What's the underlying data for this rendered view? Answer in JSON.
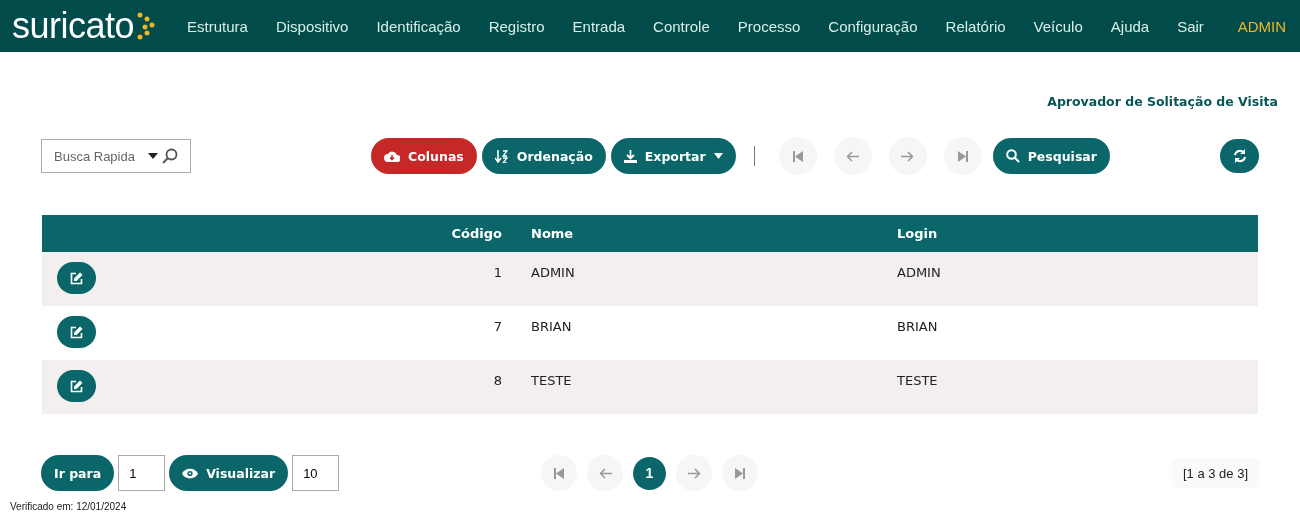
{
  "header": {
    "logo": "suricato",
    "menu": [
      "Estrutura",
      "Dispositivo",
      "Identificação",
      "Registro",
      "Entrada",
      "Controle",
      "Processo",
      "Configuração",
      "Relatório",
      "Veículo",
      "Ajuda",
      "Sair"
    ],
    "user": "ADMIN"
  },
  "page_title": "Aprovador de Solitação de Visita",
  "toolbar": {
    "quick_search": {
      "placeholder": "Busca Rapida"
    },
    "buttons": [
      {
        "label": "Colunas",
        "kind": "danger"
      },
      {
        "label": "Ordenação",
        "kind": "primary"
      },
      {
        "label": "Exportar",
        "kind": "primary"
      }
    ],
    "nav": [
      {
        "disabled": true
      },
      {
        "disabled": true
      },
      {
        "disabled": true
      },
      {
        "disabled": true
      }
    ],
    "search_button": "Pesquisar"
  },
  "table": {
    "columns": [
      "Código",
      "Nome",
      "Login"
    ],
    "rows": [
      {
        "code": "1",
        "name": "ADMIN",
        "login": "ADMIN"
      },
      {
        "code": "7",
        "name": "BRIAN",
        "login": "BRIAN"
      },
      {
        "code": "8",
        "name": "TESTE",
        "login": "TESTE"
      }
    ]
  },
  "footer": {
    "goto_button": "Ir para",
    "goto_value": "1",
    "view_button": "Visualizar",
    "page_size": "10",
    "pager": {
      "nav": [
        {
          "disabled": true
        },
        {
          "disabled": true
        },
        {
          "disabled": true
        },
        {
          "disabled": true
        }
      ],
      "pages": [
        {
          "label": "1",
          "selected": true
        }
      ]
    },
    "range": "[1 a 3 de 3]"
  },
  "verified": "Verificado em: 12/01/2024"
}
